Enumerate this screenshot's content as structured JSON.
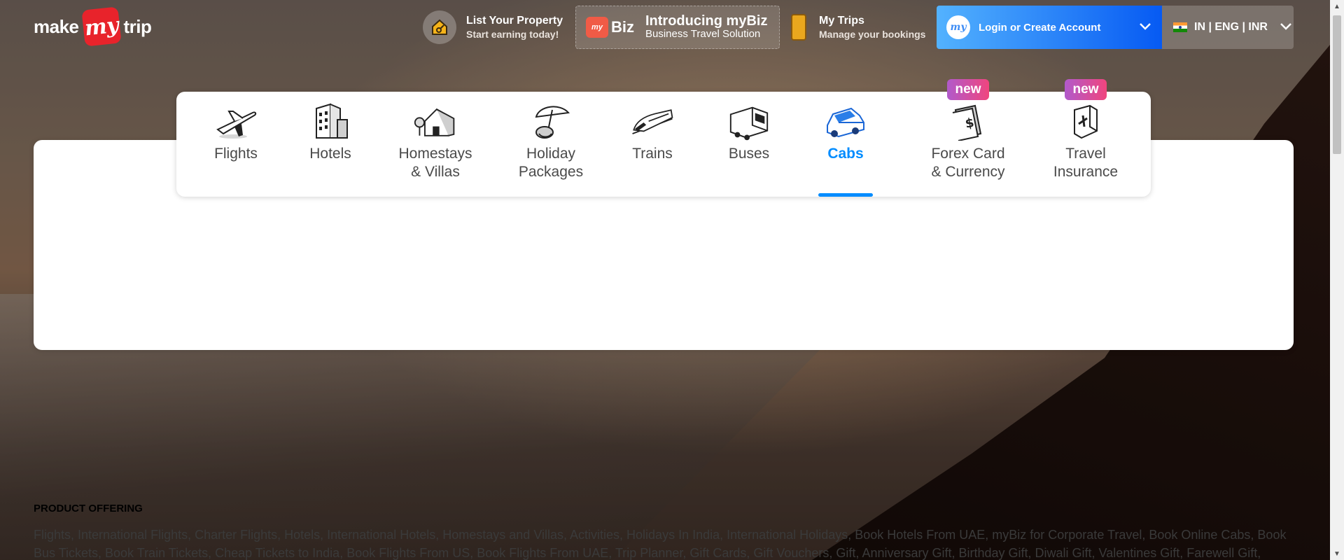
{
  "header": {
    "logo": {
      "pre": "make",
      "mid": "my",
      "post": "trip"
    },
    "list_property": {
      "title": "List Your Property",
      "subtitle": "Start earning today!",
      "icon": "key-house-icon"
    },
    "mybiz": {
      "badge_small": "my",
      "badge_label": "Biz",
      "title": "Introducing myBiz",
      "subtitle": "Business Travel Solution"
    },
    "my_trips": {
      "title": "My Trips",
      "subtitle": "Manage your bookings",
      "icon": "suitcase-icon"
    },
    "login": {
      "logo": "my",
      "label": "Login or Create Account"
    },
    "locale": {
      "label": "IN | ENG | INR"
    }
  },
  "nav": {
    "items": [
      {
        "label": "Flights",
        "icon": "plane-icon",
        "active": false
      },
      {
        "label": "Hotels",
        "icon": "hotel-icon",
        "active": false
      },
      {
        "label": "Homestays\n& Villas",
        "icon": "house-icon",
        "active": false
      },
      {
        "label": "Holiday\nPackages",
        "icon": "umbrella-icon",
        "active": false
      },
      {
        "label": "Trains",
        "icon": "train-icon",
        "active": false
      },
      {
        "label": "Buses",
        "icon": "bus-icon",
        "active": false
      },
      {
        "label": "Cabs",
        "icon": "cab-icon",
        "active": true
      },
      {
        "label": "Forex Card\n& Currency",
        "icon": "forex-card-icon",
        "active": false,
        "badge": "new"
      },
      {
        "label": "Travel\nInsurance",
        "icon": "insurance-icon",
        "active": false,
        "badge": "new"
      }
    ],
    "active_color": "#008cff"
  },
  "footer": {
    "heading": "PRODUCT OFFERING",
    "text": "Flights, International Flights, Charter Flights, Hotels, International Hotels, Homestays and Villas, Activities, Holidays In India, International Holidays, Book Hotels From UAE, myBiz for Corporate Travel, Book Online Cabs, Book Bus Tickets, Book Train Tickets, Cheap Tickets to India, Book Flights From US, Book Flights From UAE, Trip Planner, Gift Cards, Gift Vouchers, Gift, Anniversary Gift, Birthday Gift, Diwali Gift, Valentines Gift, Farewell Gift,"
  }
}
